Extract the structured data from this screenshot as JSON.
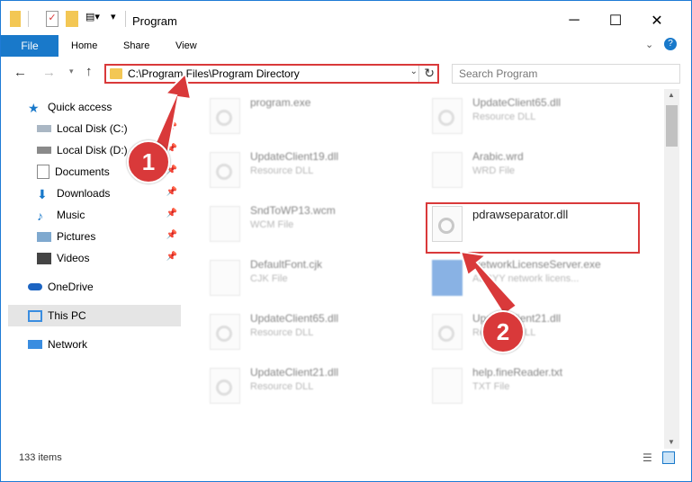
{
  "window": {
    "title": "Program"
  },
  "ribbon": {
    "tabs": [
      "File",
      "Home",
      "Share",
      "View"
    ]
  },
  "address": {
    "path": "C:\\Program Files\\Program Directory",
    "search_placeholder": "Search Program"
  },
  "sidebar": {
    "quick_access": "Quick access",
    "items": [
      "Local Disk (C:)",
      "Local Disk (D:)",
      "Documents",
      "Downloads",
      "Music",
      "Pictures",
      "Videos"
    ],
    "onedrive": "OneDrive",
    "thispc": "This PC",
    "network": "Network"
  },
  "files": [
    {
      "name": "program.exe",
      "type": ""
    },
    {
      "name": "UpdateClient65.dll",
      "type": "Resource DLL"
    },
    {
      "name": "UpdateClient19.dll",
      "type": "Resource DLL"
    },
    {
      "name": "Arabic.wrd",
      "type": "WRD File"
    },
    {
      "name": "SndToWP13.wcm",
      "type": "WCM File"
    },
    {
      "name": "pdrawseparator.dll",
      "type": ""
    },
    {
      "name": "DefaultFont.cjk",
      "type": "CJK File"
    },
    {
      "name": "NetworkLicenseServer.exe",
      "type": "ABBYY network licens..."
    },
    {
      "name": "UpdateClient65.dll",
      "type": "Resource DLL"
    },
    {
      "name": "UpdateClient21.dll",
      "type": "Resource DLL"
    },
    {
      "name": "UpdateClient21.dll",
      "type": "Resource DLL"
    },
    {
      "name": "help.fineReader.txt",
      "type": "TXT File"
    }
  ],
  "status": {
    "count": "133 items"
  },
  "annotations": {
    "step1": "1",
    "step2": "2"
  },
  "colors": {
    "accent": "#1979ca",
    "highlight": "#d9393a"
  }
}
